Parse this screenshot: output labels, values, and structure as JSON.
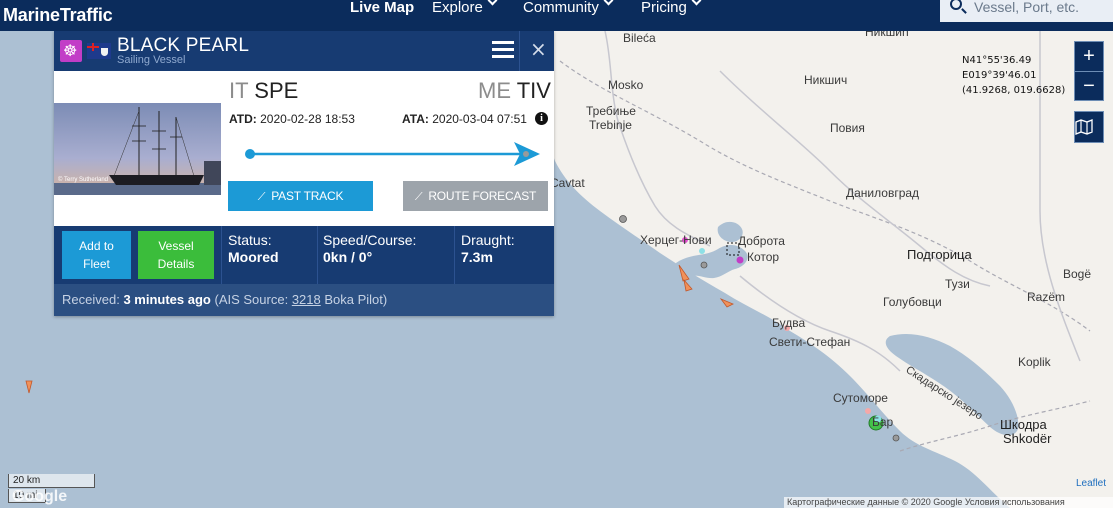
{
  "header": {
    "logo": "MarineTraffic",
    "nav": [
      {
        "label": "Live Map",
        "dropdown": false
      },
      {
        "label": "Explore",
        "dropdown": true
      },
      {
        "label": "Community",
        "dropdown": true
      },
      {
        "label": "Pricing",
        "dropdown": true
      }
    ],
    "search_placeholder": "Vessel, Port, etc."
  },
  "vessel": {
    "name": "BLACK PEARL",
    "type": "Sailing Vessel",
    "photo_credit": "© Terry Sutherland",
    "from": {
      "country": "IT",
      "port": "SPE"
    },
    "to": {
      "country": "ME",
      "port": "TIV"
    },
    "atd_label": "ATD:",
    "atd": "2020-02-28 18:53",
    "ata_label": "ATA:",
    "ata": "2020-03-04 07:51",
    "buttons": {
      "past_track": "PAST TRACK",
      "route_forecast": "ROUTE FORECAST",
      "add_to_fleet_1": "Add to",
      "add_to_fleet_2": "Fleet",
      "details_1": "Vessel",
      "details_2": "Details"
    },
    "status_label": "Status:",
    "status": "Moored",
    "speed_label": "Speed/Course:",
    "speed": "0kn / 0°",
    "draught_label": "Draught:",
    "draught": "7.3m",
    "received_label": "Received:",
    "received": "3 minutes ago",
    "ais_source_label": "(AIS Source:",
    "ais_source_id": "3218",
    "ais_source_name": "Boka Pilot)"
  },
  "map": {
    "coords": [
      "N41°55'36.49",
      "E019°39'46.01",
      "(41.9268, 019.6628)"
    ],
    "zoom_in": "+",
    "zoom_out": "−",
    "labels": {
      "bileca": "Bileća",
      "mosko": "Mosko",
      "nikshich": "Никшич",
      "trebinje_cy": "Требиње",
      "trebinje": "Trebinje",
      "povia": "Повия",
      "danilovgrad": "Даниловград",
      "avtat": "Cavtat",
      "herceg": "Херцег-Нови",
      "dobrota": "Доброта",
      "kotor": "Котор",
      "podgorica": "Подгорица",
      "tuzi": "Тузи",
      "golubovci": "Голубовци",
      "boge": "Bogë",
      "razem": "Razëm",
      "budva": "Будва",
      "sveti": "Свети-Стефан",
      "lake": "Скадарско језеро",
      "koplik": "Koplik",
      "sutomore": "Сутоморе",
      "bar": "Бар",
      "shkodra1": "Шкодра",
      "shkodra2": "Shkodër",
      "nikshic_top": "Никшић"
    },
    "scale_km": "20 km",
    "scale_mi": "10 mi",
    "attribution": "Картографические данные © 2020 Google   Условия использования",
    "leaflet": "Leaflet",
    "google": "Google"
  }
}
